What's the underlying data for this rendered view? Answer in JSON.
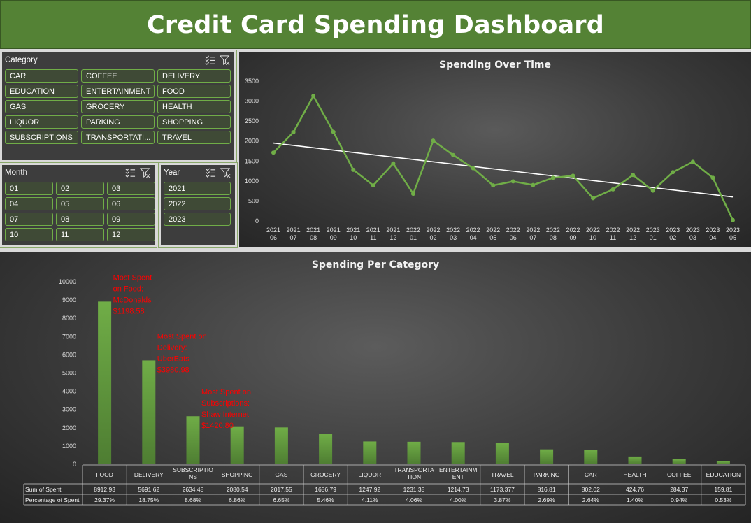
{
  "title": "Credit Card Spending Dashboard",
  "colors": {
    "accent": "#548235",
    "line": "#70ad47",
    "trend": "#ffffff",
    "annotation": "#ff0000"
  },
  "category_slicer": {
    "label": "Category",
    "icons": [
      "multi-select-icon",
      "clear-filter-icon"
    ],
    "items": [
      "CAR",
      "COFFEE",
      "DELIVERY",
      "EDUCATION",
      "ENTERTAINMENT",
      "FOOD",
      "GAS",
      "GROCERY",
      "HEALTH",
      "LIQUOR",
      "PARKING",
      "SHOPPING",
      "SUBSCRIPTIONS",
      "TRANSPORTATI...",
      "TRAVEL"
    ]
  },
  "month_slicer": {
    "label": "Month",
    "icons": [
      "multi-select-icon",
      "clear-filter-icon"
    ],
    "items": [
      "01",
      "02",
      "03",
      "04",
      "05",
      "06",
      "07",
      "08",
      "09",
      "10",
      "11",
      "12"
    ]
  },
  "year_slicer": {
    "label": "Year",
    "icons": [
      "multi-select-icon",
      "clear-filter-icon"
    ],
    "items": [
      "2021",
      "2022",
      "2023"
    ]
  },
  "chart_data": [
    {
      "type": "line",
      "title": "Spending Over Time",
      "x": [
        [
          "2021",
          "06"
        ],
        [
          "2021",
          "07"
        ],
        [
          "2021",
          "08"
        ],
        [
          "2021",
          "09"
        ],
        [
          "2021",
          "10"
        ],
        [
          "2021",
          "11"
        ],
        [
          "2021",
          "12"
        ],
        [
          "2022",
          "01"
        ],
        [
          "2022",
          "02"
        ],
        [
          "2022",
          "03"
        ],
        [
          "2022",
          "04"
        ],
        [
          "2022",
          "05"
        ],
        [
          "2022",
          "06"
        ],
        [
          "2022",
          "07"
        ],
        [
          "2022",
          "08"
        ],
        [
          "2022",
          "09"
        ],
        [
          "2022",
          "10"
        ],
        [
          "2022",
          "11"
        ],
        [
          "2022",
          "12"
        ],
        [
          "2023",
          "01"
        ],
        [
          "2023",
          "02"
        ],
        [
          "2023",
          "03"
        ],
        [
          "2023",
          "04"
        ],
        [
          "2023",
          "05"
        ]
      ],
      "series": [
        {
          "values": [
            1710,
            2220,
            3130,
            2230,
            1280,
            890,
            1440,
            680,
            2010,
            1650,
            1320,
            890,
            990,
            900,
            1080,
            1130,
            570,
            790,
            1150,
            760,
            1220,
            1480,
            1080,
            20
          ]
        }
      ],
      "trendline": {
        "start": 1950,
        "end": 600
      },
      "yticks": [
        0,
        500,
        1000,
        1500,
        2000,
        2500,
        3000,
        3500
      ],
      "ylim": [
        0,
        3500
      ],
      "grid": false,
      "legend": "none"
    },
    {
      "type": "bar",
      "title": "Spending Per Category",
      "categories": [
        "FOOD",
        "DELIVERY",
        "SUBSCRIPTIONS",
        "SHOPPING",
        "GAS",
        "GROCERY",
        "LIQUOR",
        "TRANSPORTATION",
        "ENTERTAINMENT",
        "TRAVEL",
        "PARKING",
        "CAR",
        "HEALTH",
        "COFFEE",
        "EDUCATION"
      ],
      "category_labels": [
        [
          "FOOD"
        ],
        [
          "DELIVERY"
        ],
        [
          "SUBSCRIPTIO",
          "NS"
        ],
        [
          "SHOPPING"
        ],
        [
          "GAS"
        ],
        [
          "GROCERY"
        ],
        [
          "LIQUOR"
        ],
        [
          "TRANSPORTA",
          "TION"
        ],
        [
          "ENTERTAINM",
          "ENT"
        ],
        [
          "TRAVEL"
        ],
        [
          "PARKING"
        ],
        [
          "CAR"
        ],
        [
          "HEALTH"
        ],
        [
          "COFFEE"
        ],
        [
          "EDUCATION"
        ]
      ],
      "series": [
        {
          "name": "Sum of Spent",
          "values": [
            8912.93,
            5691.62,
            2634.48,
            2080.54,
            2017.55,
            1656.79,
            1247.92,
            1231.35,
            1214.73,
            1173.377,
            816.81,
            802.02,
            424.76,
            284.37,
            159.81
          ]
        },
        {
          "name": "Percentage of Spent",
          "values": [
            "29.37%",
            "18.75%",
            "8.68%",
            "6.86%",
            "6.65%",
            "5.46%",
            "4.11%",
            "4.06%",
            "4.00%",
            "3.87%",
            "2.69%",
            "2.64%",
            "1.40%",
            "0.94%",
            "0.53%"
          ]
        }
      ],
      "table_values": [
        "8912.93",
        "5691.62",
        "2634.48",
        "2080.54",
        "2017.55",
        "1656.79",
        "1247.92",
        "1231.35",
        "1214.73",
        "1173.377",
        "816.81",
        "802.02",
        "424.76",
        "284.37",
        "159.81"
      ],
      "yticks": [
        0,
        1000,
        2000,
        3000,
        4000,
        5000,
        6000,
        7000,
        8000,
        9000,
        10000
      ],
      "ylim": [
        0,
        10000
      ],
      "grid": false,
      "annotations": [
        {
          "category": "FOOD",
          "lines": [
            "Most Spent",
            "on Food:",
            "McDonalds",
            "$1198.58"
          ]
        },
        {
          "category": "DELIVERY",
          "lines": [
            "Most Spent on",
            "Delivery:",
            "UberEats",
            "$3980.98"
          ]
        },
        {
          "category": "SUBSCRIPTIONS",
          "lines": [
            "Most Spent on",
            "Subscriptions:",
            "Shaw Internet",
            "$1420.80"
          ]
        }
      ]
    }
  ]
}
